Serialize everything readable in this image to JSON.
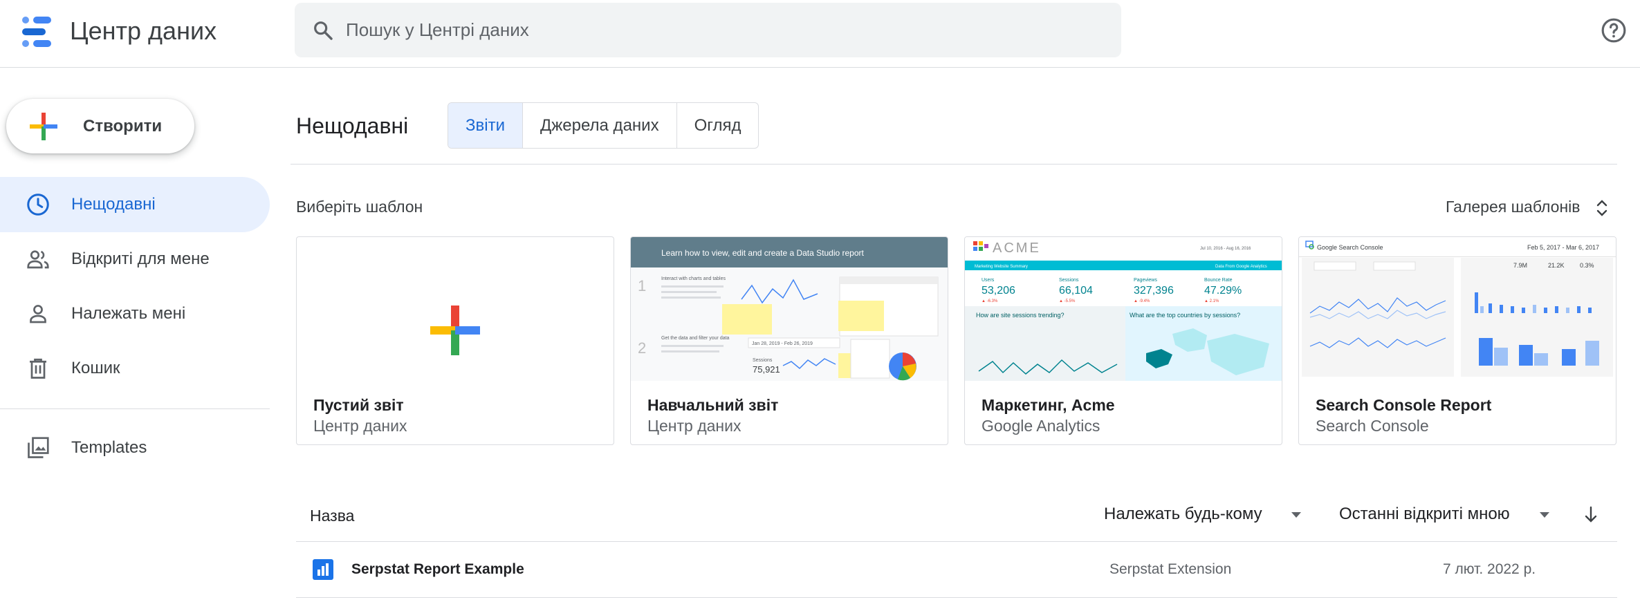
{
  "header": {
    "app_title": "Центр даних",
    "search_placeholder": "Пошук у Центрі даних",
    "help_icon": "help-circle-icon"
  },
  "sidebar": {
    "create_label": "Створити",
    "items": [
      {
        "label": "Нещодавні",
        "icon": "clock-icon",
        "active": true
      },
      {
        "label": "Відкриті для мене",
        "icon": "people-icon",
        "active": false
      },
      {
        "label": "Належать мені",
        "icon": "person-icon",
        "active": false
      },
      {
        "label": "Кошик",
        "icon": "trash-icon",
        "active": false
      },
      {
        "label": "Templates",
        "icon": "templates-icon",
        "active": false
      }
    ]
  },
  "main": {
    "title": "Нещодавні",
    "tabs": [
      {
        "label": "Звіти",
        "active": true
      },
      {
        "label": "Джерела даних",
        "active": false
      },
      {
        "label": "Огляд",
        "active": false
      }
    ],
    "choose_template": "Виберіть шаблон",
    "gallery_link": "Галерея шаблонів"
  },
  "templates": [
    {
      "title": "Пустий звіт",
      "subtitle": "Центр даних"
    },
    {
      "title": "Навчальний звіт",
      "subtitle": "Центр даних",
      "banner": "Learn how to view, edit and create a Data Studio report",
      "step1": "Interact with charts and tables",
      "step2": "Get the data and filter your data",
      "date_range": "Jan 28, 2019 - Feb 26, 2019",
      "sessions_label": "Sessions",
      "sessions_value": "75,921"
    },
    {
      "title": "Маркетинг, Acme",
      "subtitle": "Google Analytics",
      "brand": "ACME",
      "date_range": "Jul 10, 2016 - Aug 16, 2016",
      "banner_left": "Marketing Website Summary",
      "banner_right": "Data From Google Analytics",
      "kpis": [
        {
          "label": "Users",
          "value": "53,206",
          "delta": "▲ -6.3%"
        },
        {
          "label": "Sessions",
          "value": "66,104",
          "delta": "▲ -5.5%"
        },
        {
          "label": "Pageviews",
          "value": "327,396",
          "delta": "▲ -9.4%"
        },
        {
          "label": "Bounce Rate",
          "value": "47.29%",
          "delta": "▲ 2.1%"
        }
      ],
      "q1": "How are site sessions trending?",
      "q2": "What are the top countries by sessions?"
    },
    {
      "title": "Search Console Report",
      "subtitle": "Search Console",
      "header": "Google Search Console",
      "date_range": "Feb 5, 2017 - Mar 6, 2017",
      "stats": [
        "7.9M",
        "21.2K",
        "0.3%"
      ]
    }
  ],
  "table": {
    "col_name": "Назва",
    "col_owner": "Належать будь-кому",
    "col_sort": "Останні відкриті мною",
    "rows": [
      {
        "name": "Serpstat Report Example",
        "owner": "Serpstat Extension",
        "date": "7 лют. 2022 р.",
        "icon": "report-icon"
      }
    ]
  },
  "colors": {
    "accent": "#1967d2",
    "active_bg": "#e8f0fe",
    "divider": "#dadce0",
    "google_blue": "#4285f4",
    "google_red": "#ea4335",
    "google_yellow": "#fbbc04",
    "google_green": "#34a853"
  }
}
